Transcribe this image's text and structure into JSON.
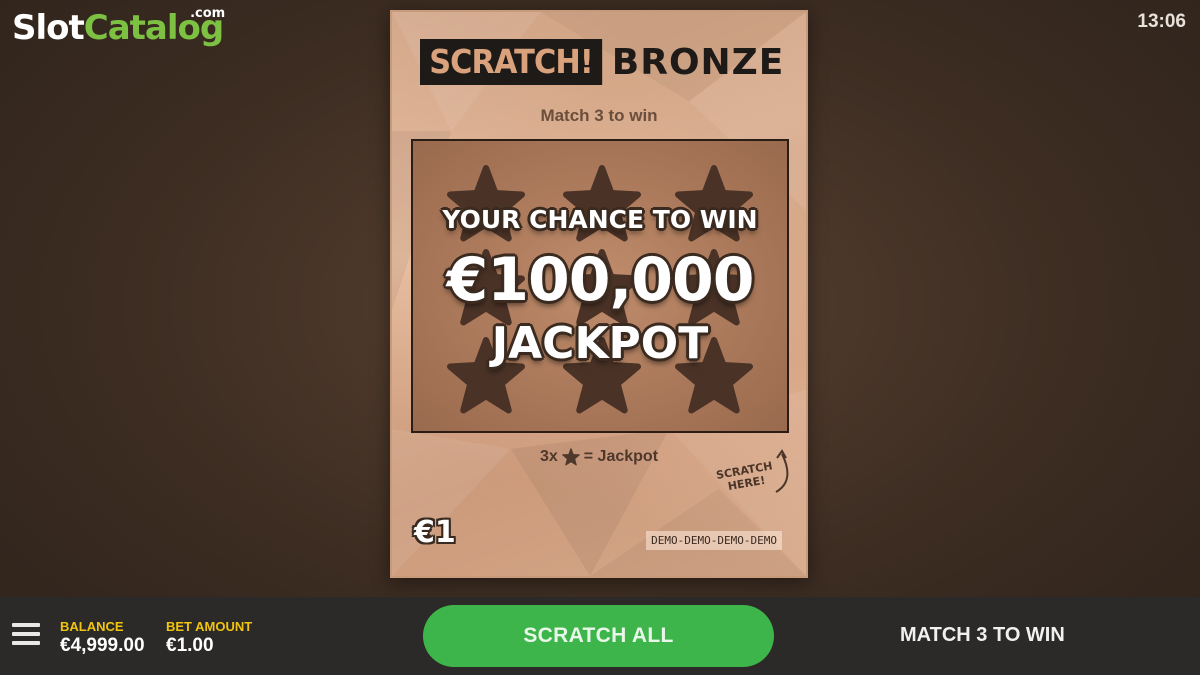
{
  "brand": {
    "logo_slot": "Slot",
    "logo_catalog": "Catalog",
    "logo_com": ".com"
  },
  "clock": "13:06",
  "ticket": {
    "title_scratch": "SCRATCH!",
    "title_bronze": "BRONZE",
    "subtitle": "Match 3 to win",
    "promo_line1": "YOUR CHANCE TO WIN",
    "promo_amount": "€100,000",
    "promo_line3": "JACKPOT",
    "rule_prefix": "3x",
    "rule_suffix": "= Jackpot",
    "scratch_hint_line1": "SCRATCH",
    "scratch_hint_line2": "HERE!",
    "price": "€1",
    "demo_label": "DEMO-DEMO-DEMO-DEMO",
    "star_slots": 9
  },
  "bottom_bar": {
    "balance_label": "BALANCE",
    "balance_value": "€4,999.00",
    "bet_label": "BET AMOUNT",
    "bet_value": "€1.00",
    "scratch_all_label": "SCRATCH ALL",
    "match_info": "MATCH 3 TO WIN"
  },
  "colors": {
    "accent_green": "#3eb54a",
    "label_yellow": "#f1c40f",
    "ticket_bronze": "#dba886",
    "logo_green": "#7cc142"
  }
}
